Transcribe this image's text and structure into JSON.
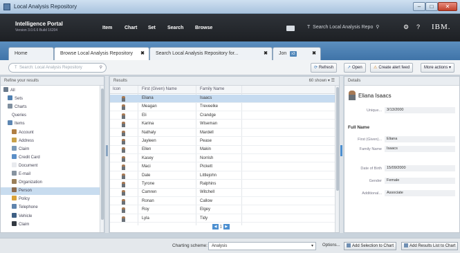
{
  "window": {
    "title": "Local Analysis Repository"
  },
  "app": {
    "name": "Intelligence Portal",
    "version": "Version 3.0.6.6 Build 16204"
  },
  "nav": [
    "Item",
    "Chart",
    "Set",
    "Search",
    "Browse"
  ],
  "topsearch": {
    "label": "Search Local Analysis Repo"
  },
  "brand_logo": "IBM.",
  "tabs": [
    {
      "label": "Home"
    },
    {
      "label": "Browse Local Analysis Repository",
      "close": "✖"
    },
    {
      "label": "Search Local Analysis Repository for...",
      "close": "✖"
    },
    {
      "label": "Jon",
      "badge": "x3",
      "close": "✖"
    }
  ],
  "search": {
    "placeholder": "Search: Local Analysis Repository"
  },
  "toolbar": {
    "refresh": "Refresh",
    "open": "Open",
    "alert": "Create alert feed",
    "more": "More actions"
  },
  "refine": {
    "title": "Refine your results",
    "items": [
      {
        "label": "All",
        "icon": "all-icon",
        "color": "#6b7b8c",
        "indent": 0
      },
      {
        "label": "Sets",
        "icon": "sets-icon",
        "color": "#4f7fb0",
        "indent": 1
      },
      {
        "label": "Charts",
        "icon": "charts-icon",
        "color": "#7f8f9f",
        "indent": 1
      },
      {
        "label": "Queries",
        "icon": "",
        "color": "",
        "indent": 2
      },
      {
        "label": "Items",
        "icon": "items-icon",
        "color": "#5d86b2",
        "indent": 1
      },
      {
        "label": "Account",
        "icon": "account-icon",
        "color": "#b07f44",
        "indent": 2
      },
      {
        "label": "Address",
        "icon": "address-icon",
        "color": "#c9a24a",
        "indent": 2
      },
      {
        "label": "Claim",
        "icon": "claim-icon",
        "color": "#7a9ab8",
        "indent": 2
      },
      {
        "label": "Credit Card",
        "icon": "credit-card-icon",
        "color": "#5b8fc8",
        "indent": 2
      },
      {
        "label": "Document",
        "icon": "document-icon",
        "color": "#e8eaee",
        "indent": 2
      },
      {
        "label": "E-mail",
        "icon": "email-icon",
        "color": "#8793a0",
        "indent": 2
      },
      {
        "label": "Organization",
        "icon": "organization-icon",
        "color": "#9a7f5a",
        "indent": 2
      },
      {
        "label": "Person",
        "icon": "person-icon",
        "color": "#8c6b4f",
        "indent": 2,
        "selected": true
      },
      {
        "label": "Policy",
        "icon": "policy-icon",
        "color": "#d9a23a",
        "indent": 2
      },
      {
        "label": "Telephone",
        "icon": "telephone-icon",
        "color": "#5f84ad",
        "indent": 2
      },
      {
        "label": "Vehicle",
        "icon": "vehicle-icon",
        "color": "#3e5f84",
        "indent": 2
      },
      {
        "label": "Claim",
        "icon": "claim-icon",
        "color": "#333a42",
        "indent": 2
      }
    ]
  },
  "results": {
    "title": "Results",
    "count": "60 shown",
    "columns": [
      "Icon",
      "First (Given) Name",
      "Family Name"
    ],
    "rows": [
      {
        "first": "Eliana",
        "family": "Isaacs"
      },
      {
        "first": "Meagan",
        "family": "Treveelke"
      },
      {
        "first": "Eli",
        "family": "Crandge"
      },
      {
        "first": "Karina",
        "family": "Wiseman"
      },
      {
        "first": "Nathaly",
        "family": "Mardell"
      },
      {
        "first": "Jayleen",
        "family": "Pease"
      },
      {
        "first": "Ellen",
        "family": "Makin"
      },
      {
        "first": "Kasey",
        "family": "Norrish"
      },
      {
        "first": "Maci",
        "family": "Pickett"
      },
      {
        "first": "Dale",
        "family": "Littlejohn"
      },
      {
        "first": "Tyrone",
        "family": "Ralphins"
      },
      {
        "first": "Camren",
        "family": "Witchell"
      },
      {
        "first": "Ronan",
        "family": "Callow"
      },
      {
        "first": "Roy",
        "family": "Elgey"
      },
      {
        "first": "Lyla",
        "family": "Tidy"
      }
    ],
    "page": "1"
  },
  "details": {
    "title": "Details",
    "name": "Eliana Isaacs",
    "unique_label": "Unique...",
    "unique_value": "3/13/2000",
    "section": "Full Name",
    "fields": [
      {
        "label": "First (Given)...",
        "value": "Eliana"
      },
      {
        "label": "Family Name",
        "value": "Isaacs"
      }
    ],
    "fields2": [
      {
        "label": "Date of Birth",
        "value": "15/09/2000"
      },
      {
        "label": "Gender",
        "value": "Female"
      },
      {
        "label": "Additional...",
        "value": "Associate"
      }
    ]
  },
  "footer": {
    "charting_label": "Charting scheme:",
    "scheme": "Analysis",
    "options": "Options...",
    "add_selection": "Add Selection to Chart",
    "add_results": "Add Results List to Chart"
  }
}
